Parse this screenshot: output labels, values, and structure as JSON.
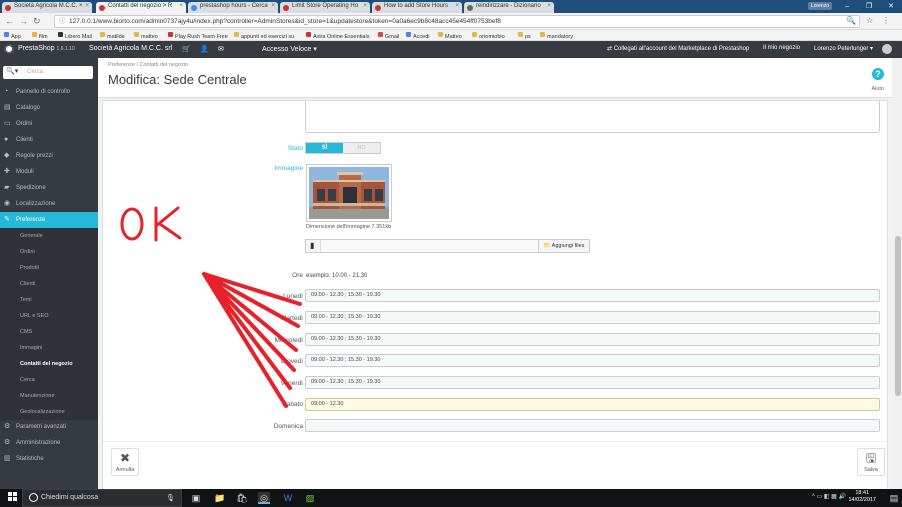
{
  "browser": {
    "tabs": [
      {
        "label": "Società Agricola M.C.C. × "
      },
      {
        "label": "Contatti del negozio > R"
      },
      {
        "label": "prestashop hours - Cerca"
      },
      {
        "label": "Limit Store Operating Ho"
      },
      {
        "label": "How to add Store Hours"
      },
      {
        "label": "reindirizzare - Dizionario"
      }
    ],
    "profile_chip": "Lorenzo",
    "url": "127.0.0.1/www.biorto.com/admin0737ajy4u/index.php?controller=AdminStores&id_store=1&updatestore&token=0a0a6ec9b8c48acc45e454ff0753bef8",
    "bookmarks": [
      "App",
      "film",
      "Libero Mail",
      "matilde",
      "matteo",
      "Play Rush Team Free",
      "appunti ed esercizi su",
      "Avira Online Essentials",
      "Gmail",
      "Accedi",
      "Matteo",
      "ortomiobio",
      "ps",
      "mandatory"
    ]
  },
  "ps_header": {
    "brand": "PrestaShop",
    "version": "1.6.1.10",
    "shop_name": "Società Agricola M.C.C. srl",
    "quick_access": "Accesso Veloce",
    "marketplace_link": "Collegati all'account del Marketplace di Prestashop",
    "my_shop": "Il mio negozio",
    "user": "Lorenzo Peterlunger"
  },
  "sidebar": {
    "search_placeholder": "Cerca",
    "items": [
      {
        "label": "Pannello di controllo",
        "icon": "dashboard-icon"
      },
      {
        "label": "Catalogo",
        "icon": "book-icon"
      },
      {
        "label": "Ordini",
        "icon": "credit-card-icon"
      },
      {
        "label": "Clienti",
        "icon": "user-icon"
      },
      {
        "label": "Regole prezzi",
        "icon": "tags-icon"
      },
      {
        "label": "Moduli",
        "icon": "puzzle-icon"
      },
      {
        "label": "Spedizione",
        "icon": "truck-icon"
      },
      {
        "label": "Localizzazione",
        "icon": "globe-icon"
      },
      {
        "label": "Preferenze",
        "icon": "wrench-icon"
      }
    ],
    "submenu": [
      "Generale",
      "Ordini",
      "Prodotti",
      "Clienti",
      "Temi",
      "URL e SEO",
      "CMS",
      "Immagini",
      "Contatti del negozio",
      "Cerca",
      "Manutenzione",
      "Geolocalizzazione"
    ],
    "bottom_items": [
      {
        "label": "Parametri avanzati",
        "icon": "cogs-icon"
      },
      {
        "label": "Amministrazione",
        "icon": "cog-icon"
      },
      {
        "label": "Statistiche",
        "icon": "bar-chart-icon"
      }
    ]
  },
  "page": {
    "breadcrumb_1": "Preferenze",
    "breadcrumb_sep": "/",
    "breadcrumb_2": "Contatti del negozio",
    "title": "Modifica: Sede Centrale",
    "help_label": "Aiuto"
  },
  "form": {
    "stato_label": "Stato",
    "stato_yes": "SÌ",
    "stato_no": "NO",
    "image_label": "Immagine",
    "image_size": "Dimensione dell'immagine 7.351kb",
    "add_files": "Aggiungi files",
    "hours_label": "Ore",
    "hours_hint": "esempio: 10.00 - 21.30",
    "days": [
      {
        "label": "Lunedì",
        "value": "09.00 - 12.30 ; 15.30 - 19.30"
      },
      {
        "label": "Martedì",
        "value": "09.00 - 12.30 ; 15.30 - 19.30"
      },
      {
        "label": "Mercoledì",
        "value": "09.00 - 12.30 ; 15.30 - 19.30"
      },
      {
        "label": "Giovedì",
        "value": "09.00 - 12.30 ; 15.30 - 19.30"
      },
      {
        "label": "Venerdì",
        "value": "09.00 - 12.30 ; 15.30 - 19.30"
      },
      {
        "label": "Sabato",
        "value": "09.00 - 12.30"
      },
      {
        "label": "Domenica",
        "value": ""
      }
    ],
    "cancel_label": "Annulla",
    "save_label": "Salva"
  },
  "annotation": {
    "text": "OK",
    "color": "#e8202a"
  },
  "taskbar": {
    "search_placeholder": "Chiedimi qualcosa",
    "time": "18:41",
    "date": "14/02/2017"
  },
  "colors": {
    "accent": "#25b9d7",
    "sidebar_bg": "#363a41"
  }
}
